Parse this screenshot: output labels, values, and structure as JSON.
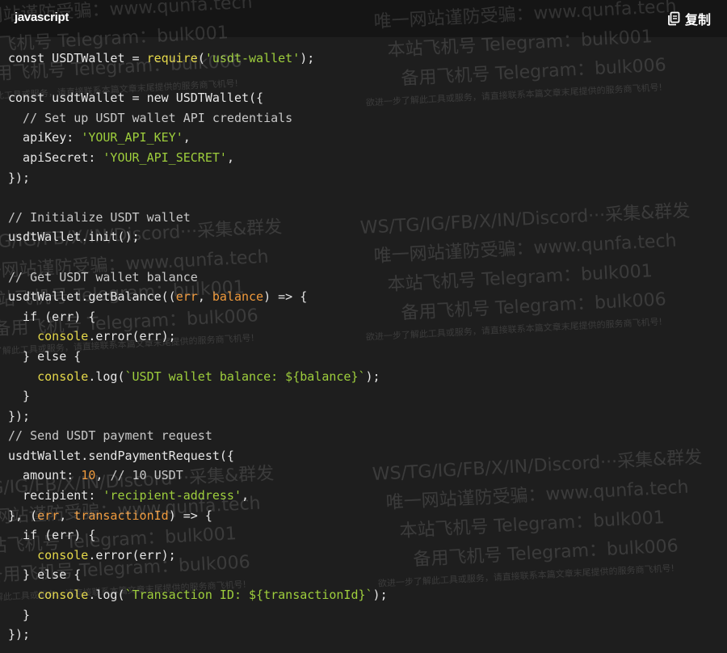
{
  "header": {
    "language": "javascript",
    "copy_label": "复制"
  },
  "code_lines": [
    [
      [
        "t",
        "const USDTWallet = "
      ],
      [
        "f",
        "require"
      ],
      [
        "t",
        "("
      ],
      [
        "s",
        "'usdt-wallet'"
      ],
      [
        "t",
        ");"
      ]
    ],
    [],
    [
      [
        "t",
        "const usdtWallet = new USDTWallet({"
      ]
    ],
    [
      [
        "c",
        "  // Set up USDT wallet API credentials"
      ]
    ],
    [
      [
        "t",
        "  apiKey: "
      ],
      [
        "s",
        "'YOUR_API_KEY'"
      ],
      [
        "t",
        ","
      ]
    ],
    [
      [
        "t",
        "  apiSecret: "
      ],
      [
        "s",
        "'YOUR_API_SECRET'"
      ],
      [
        "t",
        ","
      ]
    ],
    [
      [
        "t",
        "});"
      ]
    ],
    [],
    [
      [
        "c",
        "// Initialize USDT wallet"
      ]
    ],
    [
      [
        "t",
        "usdtWallet.init();"
      ]
    ],
    [],
    [
      [
        "c",
        "// Get USDT wallet balance"
      ]
    ],
    [
      [
        "t",
        "usdtWallet.getBalance(("
      ],
      [
        "p",
        "err"
      ],
      [
        "t",
        ", "
      ],
      [
        "p",
        "balance"
      ],
      [
        "t",
        ") => {"
      ]
    ],
    [
      [
        "t",
        "  if (err) {"
      ]
    ],
    [
      [
        "t",
        "    "
      ],
      [
        "f",
        "console"
      ],
      [
        "t",
        ".error(err);"
      ]
    ],
    [
      [
        "t",
        "  } else {"
      ]
    ],
    [
      [
        "t",
        "    "
      ],
      [
        "f",
        "console"
      ],
      [
        "t",
        ".log("
      ],
      [
        "s",
        "`USDT wallet balance: ${balance}`"
      ],
      [
        "t",
        ");"
      ]
    ],
    [
      [
        "t",
        "  }"
      ]
    ],
    [
      [
        "t",
        "});"
      ]
    ],
    [
      [
        "c",
        "// Send USDT payment request"
      ]
    ],
    [
      [
        "t",
        "usdtWallet.sendPaymentRequest({"
      ]
    ],
    [
      [
        "t",
        "  amount: "
      ],
      [
        "n",
        "10"
      ],
      [
        "t",
        ", "
      ],
      [
        "c",
        "// 10 USDT"
      ]
    ],
    [
      [
        "t",
        "  recipient: "
      ],
      [
        "s",
        "'recipient-address'"
      ],
      [
        "t",
        ","
      ]
    ],
    [
      [
        "t",
        "}, ("
      ],
      [
        "p",
        "err"
      ],
      [
        "t",
        ", "
      ],
      [
        "p",
        "transactionId"
      ],
      [
        "t",
        ") => {"
      ]
    ],
    [
      [
        "t",
        "  if (err) {"
      ]
    ],
    [
      [
        "t",
        "    "
      ],
      [
        "f",
        "console"
      ],
      [
        "t",
        ".error(err);"
      ]
    ],
    [
      [
        "t",
        "  } else {"
      ]
    ],
    [
      [
        "t",
        "    "
      ],
      [
        "f",
        "console"
      ],
      [
        "t",
        ".log("
      ],
      [
        "s",
        "`Transaction ID: ${transactionId}`"
      ],
      [
        "t",
        ");"
      ]
    ],
    [
      [
        "t",
        "  }"
      ]
    ],
    [
      [
        "t",
        "});"
      ]
    ]
  ],
  "watermark": {
    "lines": [
      "WS/TG/IG/FB/X/IN/Discord···采集&群发",
      "唯一网站谨防受骗：www.qunfa.tech",
      "本站飞机号 Telegram：bulk001",
      "备用飞机号 Telegram：bulk006"
    ],
    "small": "欲进一步了解此工具或服务，请直接联系本篇文章末尾提供的服务商飞机号!"
  }
}
